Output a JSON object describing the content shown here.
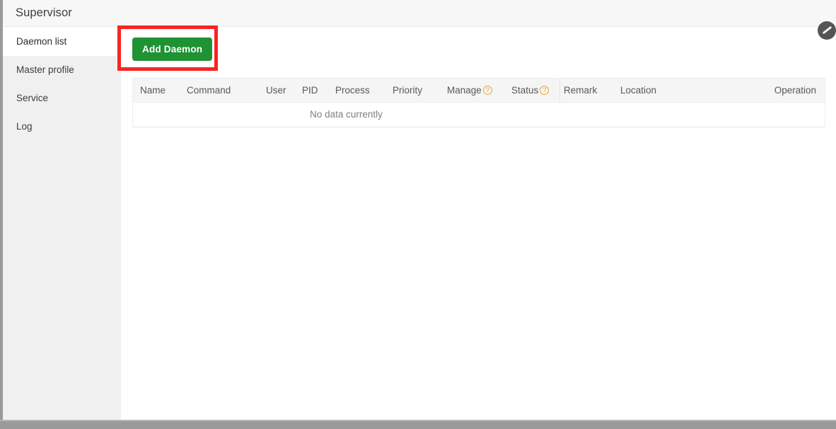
{
  "header": {
    "title": "Supervisor"
  },
  "sidebar": {
    "items": [
      {
        "label": "Daemon list"
      },
      {
        "label": "Master profile"
      },
      {
        "label": "Service"
      },
      {
        "label": "Log"
      }
    ]
  },
  "toolbar": {
    "add_daemon_label": "Add Daemon"
  },
  "annotation": {
    "color": "#fb2323",
    "target": "Add Daemon"
  },
  "table": {
    "columns": [
      {
        "label": "Name",
        "help": false
      },
      {
        "label": "Command",
        "help": false
      },
      {
        "label": "User",
        "help": false
      },
      {
        "label": "PID",
        "help": false
      },
      {
        "label": "Process",
        "help": false
      },
      {
        "label": "Priority",
        "help": false
      },
      {
        "label": "Manage",
        "help": true
      },
      {
        "label": "Status",
        "help": true
      },
      {
        "label": "Remark",
        "help": false
      },
      {
        "label": "Location",
        "help": false
      },
      {
        "label": "Operation",
        "help": false
      }
    ],
    "help_icon_glyph": "?",
    "help_icon_color": "#e8a33d",
    "empty_text": "No data currently",
    "rows": []
  },
  "colors": {
    "accent_green": "#1f9233",
    "annotation_red": "#fb2323",
    "sidebar_bg": "#f0f0f0",
    "header_bg": "#f7f7f7",
    "table_header_bg": "#f5f5f5"
  }
}
